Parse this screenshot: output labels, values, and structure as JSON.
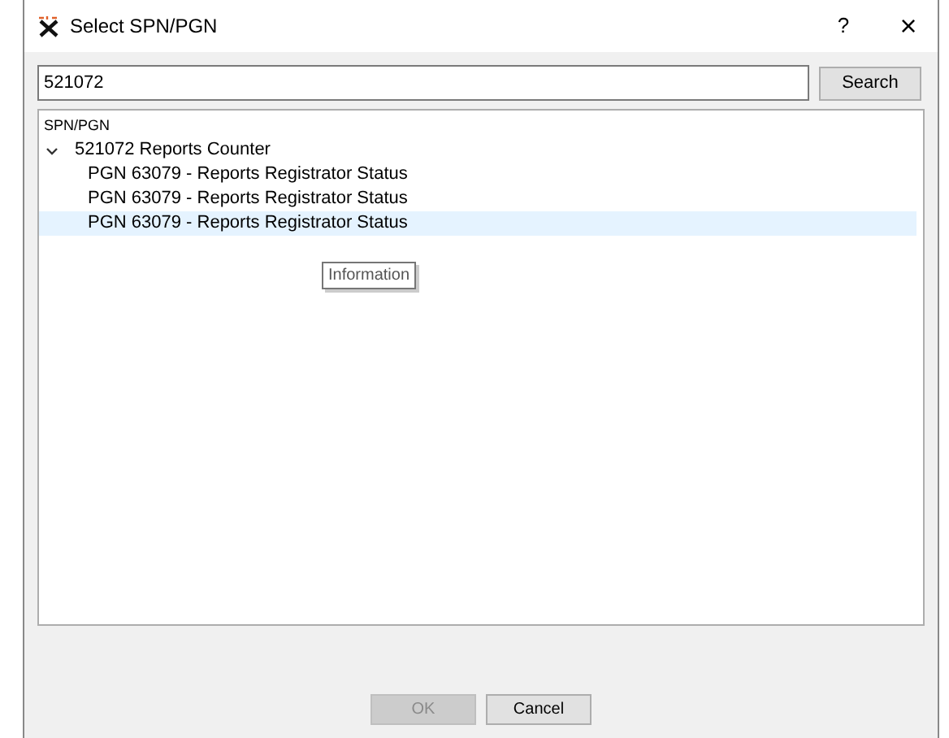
{
  "window": {
    "title": "Select SPN/PGN",
    "help": "?",
    "close": "×"
  },
  "search": {
    "value": "521072",
    "button": "Search"
  },
  "tree": {
    "header": "SPN/PGN",
    "items": [
      {
        "label": "521072 Reports Counter",
        "expanded": true,
        "selected": false,
        "children": [
          {
            "label": "PGN 63079 - Reports Registrator Status",
            "selected": false
          },
          {
            "label": "PGN 63079 - Reports Registrator Status",
            "selected": false
          },
          {
            "label": "PGN 63079 - Reports Registrator Status",
            "selected": true
          }
        ]
      }
    ]
  },
  "tooltip": "Information",
  "buttons": [
    {
      "label": "OK",
      "disabled": true
    },
    {
      "label": "Cancel",
      "disabled": false
    }
  ]
}
